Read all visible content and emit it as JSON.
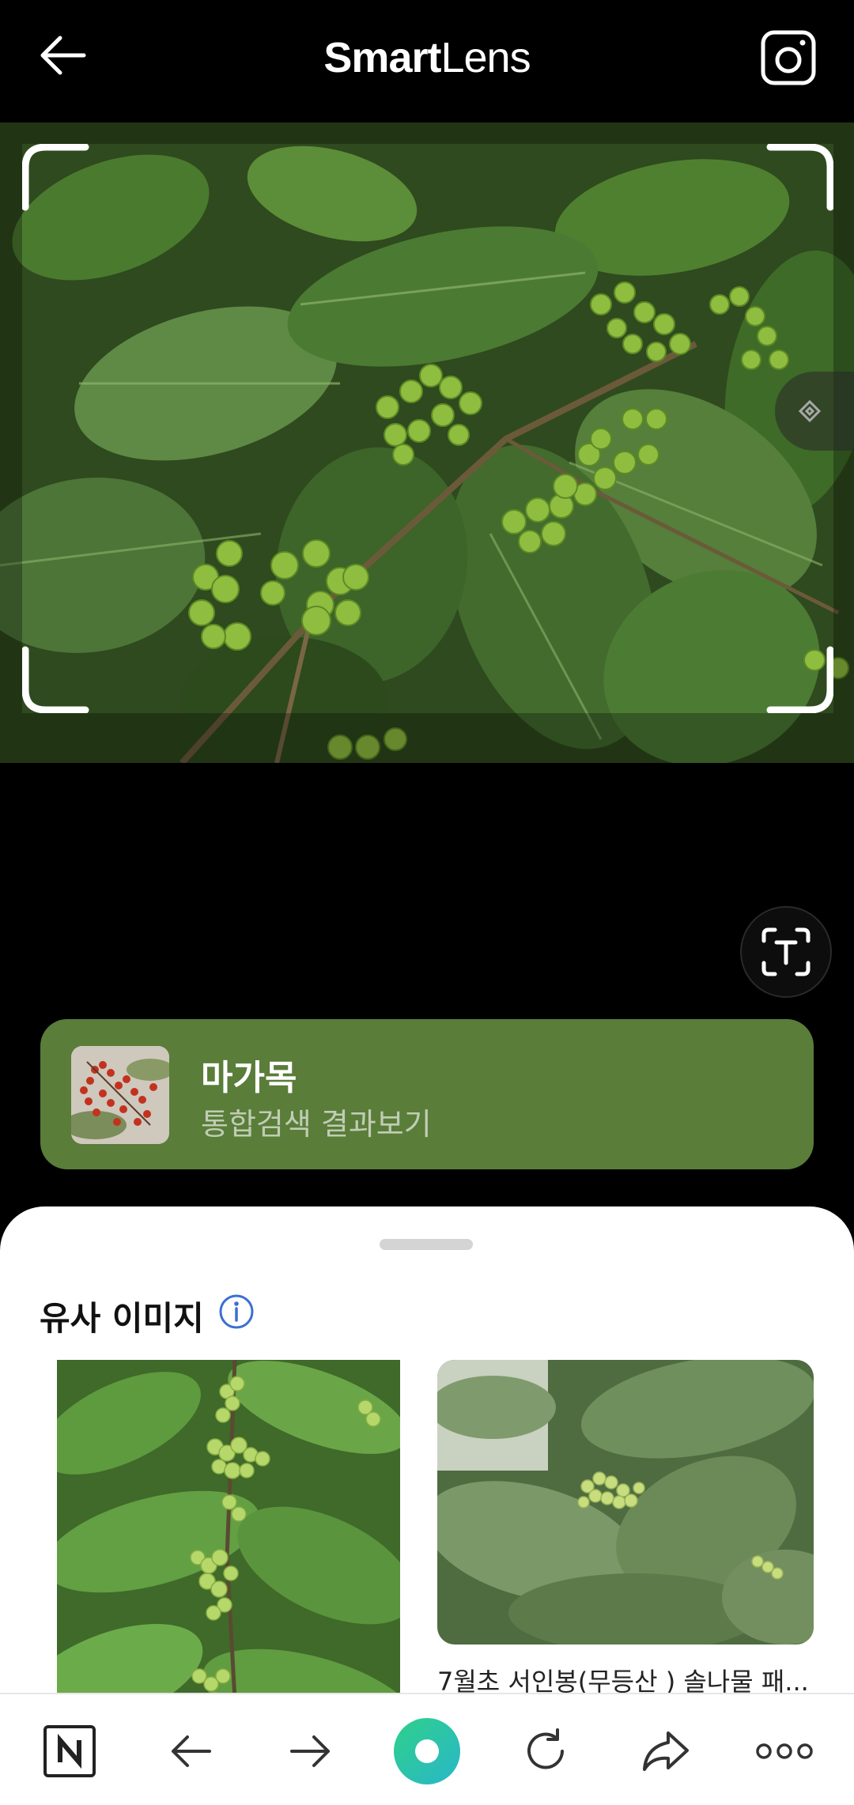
{
  "header": {
    "title_bold": "Smart",
    "title_light": "Lens",
    "back_icon": "arrow-left-icon",
    "camera_icon": "camera-icon"
  },
  "photo": {
    "description_icon": "crop-frame-icon",
    "side_handle_icon": "diamond-handle-icon"
  },
  "text_detect": {
    "icon": "text-scan-icon"
  },
  "result": {
    "name": "마가목",
    "subtitle": "통합검색 결과보기",
    "card_color": "#5a7d3a"
  },
  "similar": {
    "title": "유사 이미지",
    "info_icon": "info-icon",
    "items": [
      {
        "caption": ""
      },
      {
        "caption": "7월초 서인봉(무등산 ) 솔나물 패..."
      }
    ]
  },
  "navbar": {
    "items": [
      {
        "icon": "naver-n-icon"
      },
      {
        "icon": "arrow-left-icon"
      },
      {
        "icon": "arrow-right-icon"
      },
      {
        "icon": "green-dot-icon"
      },
      {
        "icon": "refresh-icon"
      },
      {
        "icon": "share-icon"
      },
      {
        "icon": "more-icon"
      }
    ]
  },
  "colors": {
    "accent_green": "#5a7d3a",
    "info_blue": "#3b6fd1"
  }
}
